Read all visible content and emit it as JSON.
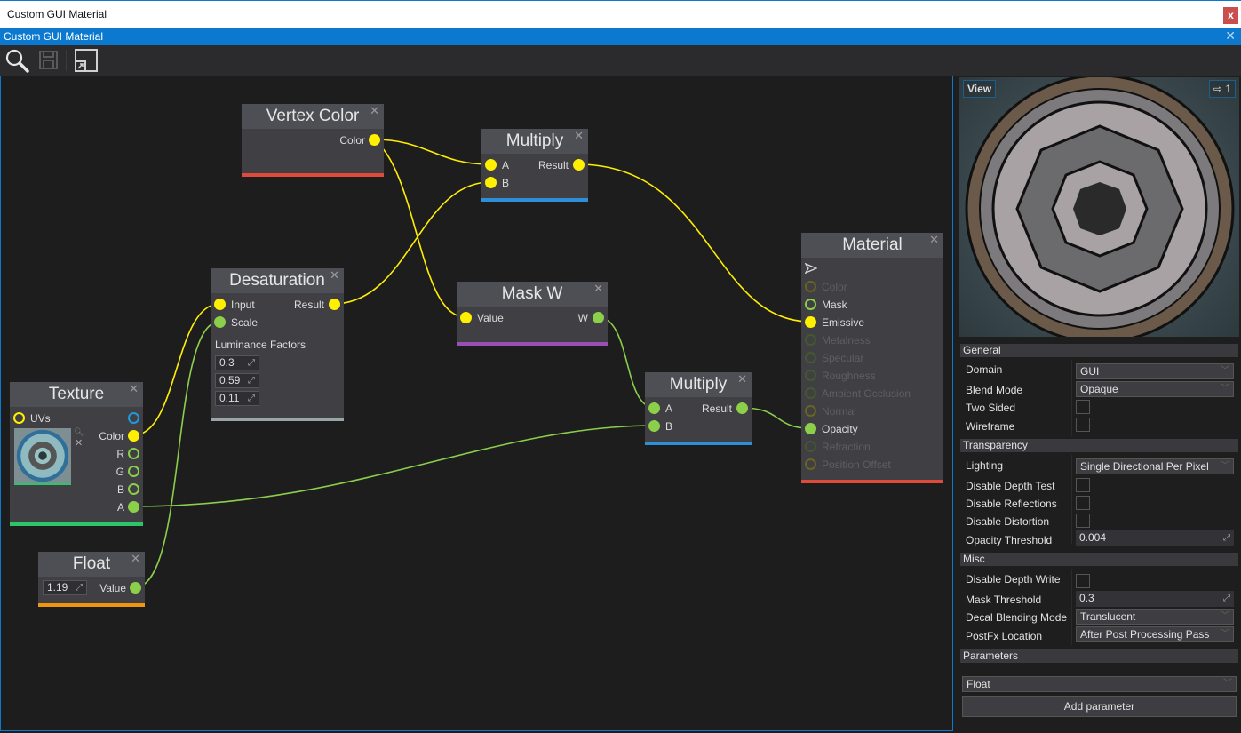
{
  "os_window": {
    "title": "Custom GUI Material",
    "close_label": "x"
  },
  "editor_window": {
    "title": "Custom GUI Material",
    "close_label": "✕"
  },
  "toolbar": {
    "buttons": [
      {
        "name": "search-icon",
        "enabled": true
      },
      {
        "name": "save-icon",
        "enabled": false
      },
      {
        "name": "toggle-properties-icon",
        "enabled": true
      }
    ]
  },
  "graph": {
    "nodes": {
      "vertex_color": {
        "title": "Vertex Color",
        "outputs": [
          "Color"
        ],
        "strip_color": "#e04a3b"
      },
      "multiply1": {
        "title": "Multiply",
        "inputs": [
          "A",
          "B"
        ],
        "outputs": [
          "Result"
        ],
        "strip_color": "#2d8fd8"
      },
      "desaturation": {
        "title": "Desaturation",
        "inputs": [
          "Input",
          "Scale"
        ],
        "outputs": [
          "Result"
        ],
        "section_label": "Luminance Factors",
        "factors": [
          "0.3",
          "0.59",
          "0.11"
        ],
        "strip_color": "#9aa6a6"
      },
      "mask_w": {
        "title": "Mask W",
        "inputs": [
          "Value"
        ],
        "outputs": [
          "W"
        ],
        "strip_color": "#9b4fb5"
      },
      "multiply2": {
        "title": "Multiply",
        "inputs": [
          "A",
          "B"
        ],
        "outputs": [
          "Result"
        ],
        "strip_color": "#2d8fd8"
      },
      "texture": {
        "title": "Texture",
        "inputs": [
          "UVs"
        ],
        "outputs": [
          "",
          "Color",
          "R",
          "G",
          "B",
          "A"
        ],
        "strip_color": "#2ec46a"
      },
      "float": {
        "title": "Float",
        "value": "1.19",
        "outputs": [
          "Value"
        ],
        "strip_color": "#f0950e"
      },
      "material": {
        "title": "Material",
        "inputs": [
          {
            "label": "Color",
            "connected": false
          },
          {
            "label": "Mask",
            "connected": false,
            "active": true
          },
          {
            "label": "Emissive",
            "connected": true
          },
          {
            "label": "Metalness",
            "connected": false
          },
          {
            "label": "Specular",
            "connected": false
          },
          {
            "label": "Roughness",
            "connected": false
          },
          {
            "label": "Ambient Occlusion",
            "connected": false
          },
          {
            "label": "Normal",
            "connected": false
          },
          {
            "label": "Opacity",
            "connected": true
          },
          {
            "label": "Refraction",
            "connected": false
          },
          {
            "label": "Position Offset",
            "connected": false
          }
        ],
        "strip_color": "#e04a3b"
      }
    },
    "wire_colors": {
      "color": "#ffef00",
      "float": "#8bcf4b"
    }
  },
  "properties": {
    "preview": {
      "view_label": "View",
      "camera_label": "1"
    },
    "sections": {
      "general": {
        "title": "General",
        "domain_label": "Domain",
        "domain_value": "GUI",
        "blend_label": "Blend Mode",
        "blend_value": "Opaque",
        "two_sided_label": "Two Sided",
        "two_sided": false,
        "wireframe_label": "Wireframe",
        "wireframe": false
      },
      "transparency": {
        "title": "Transparency",
        "lighting_label": "Lighting",
        "lighting_value": "Single Directional Per Pixel",
        "disable_depth_test_label": "Disable Depth Test",
        "disable_reflections_label": "Disable Reflections",
        "disable_distortion_label": "Disable Distortion",
        "opacity_threshold_label": "Opacity Threshold",
        "opacity_threshold": "0.004"
      },
      "misc": {
        "title": "Misc",
        "disable_depth_write_label": "Disable Depth Write",
        "mask_threshold_label": "Mask Threshold",
        "mask_threshold": "0.3",
        "decal_label": "Decal Blending Mode",
        "decal_value": "Translucent",
        "postfx_label": "PostFx Location",
        "postfx_value": "After Post Processing Pass"
      },
      "parameters": {
        "title": "Parameters",
        "type_value": "Float",
        "add_label": "Add parameter"
      }
    }
  }
}
